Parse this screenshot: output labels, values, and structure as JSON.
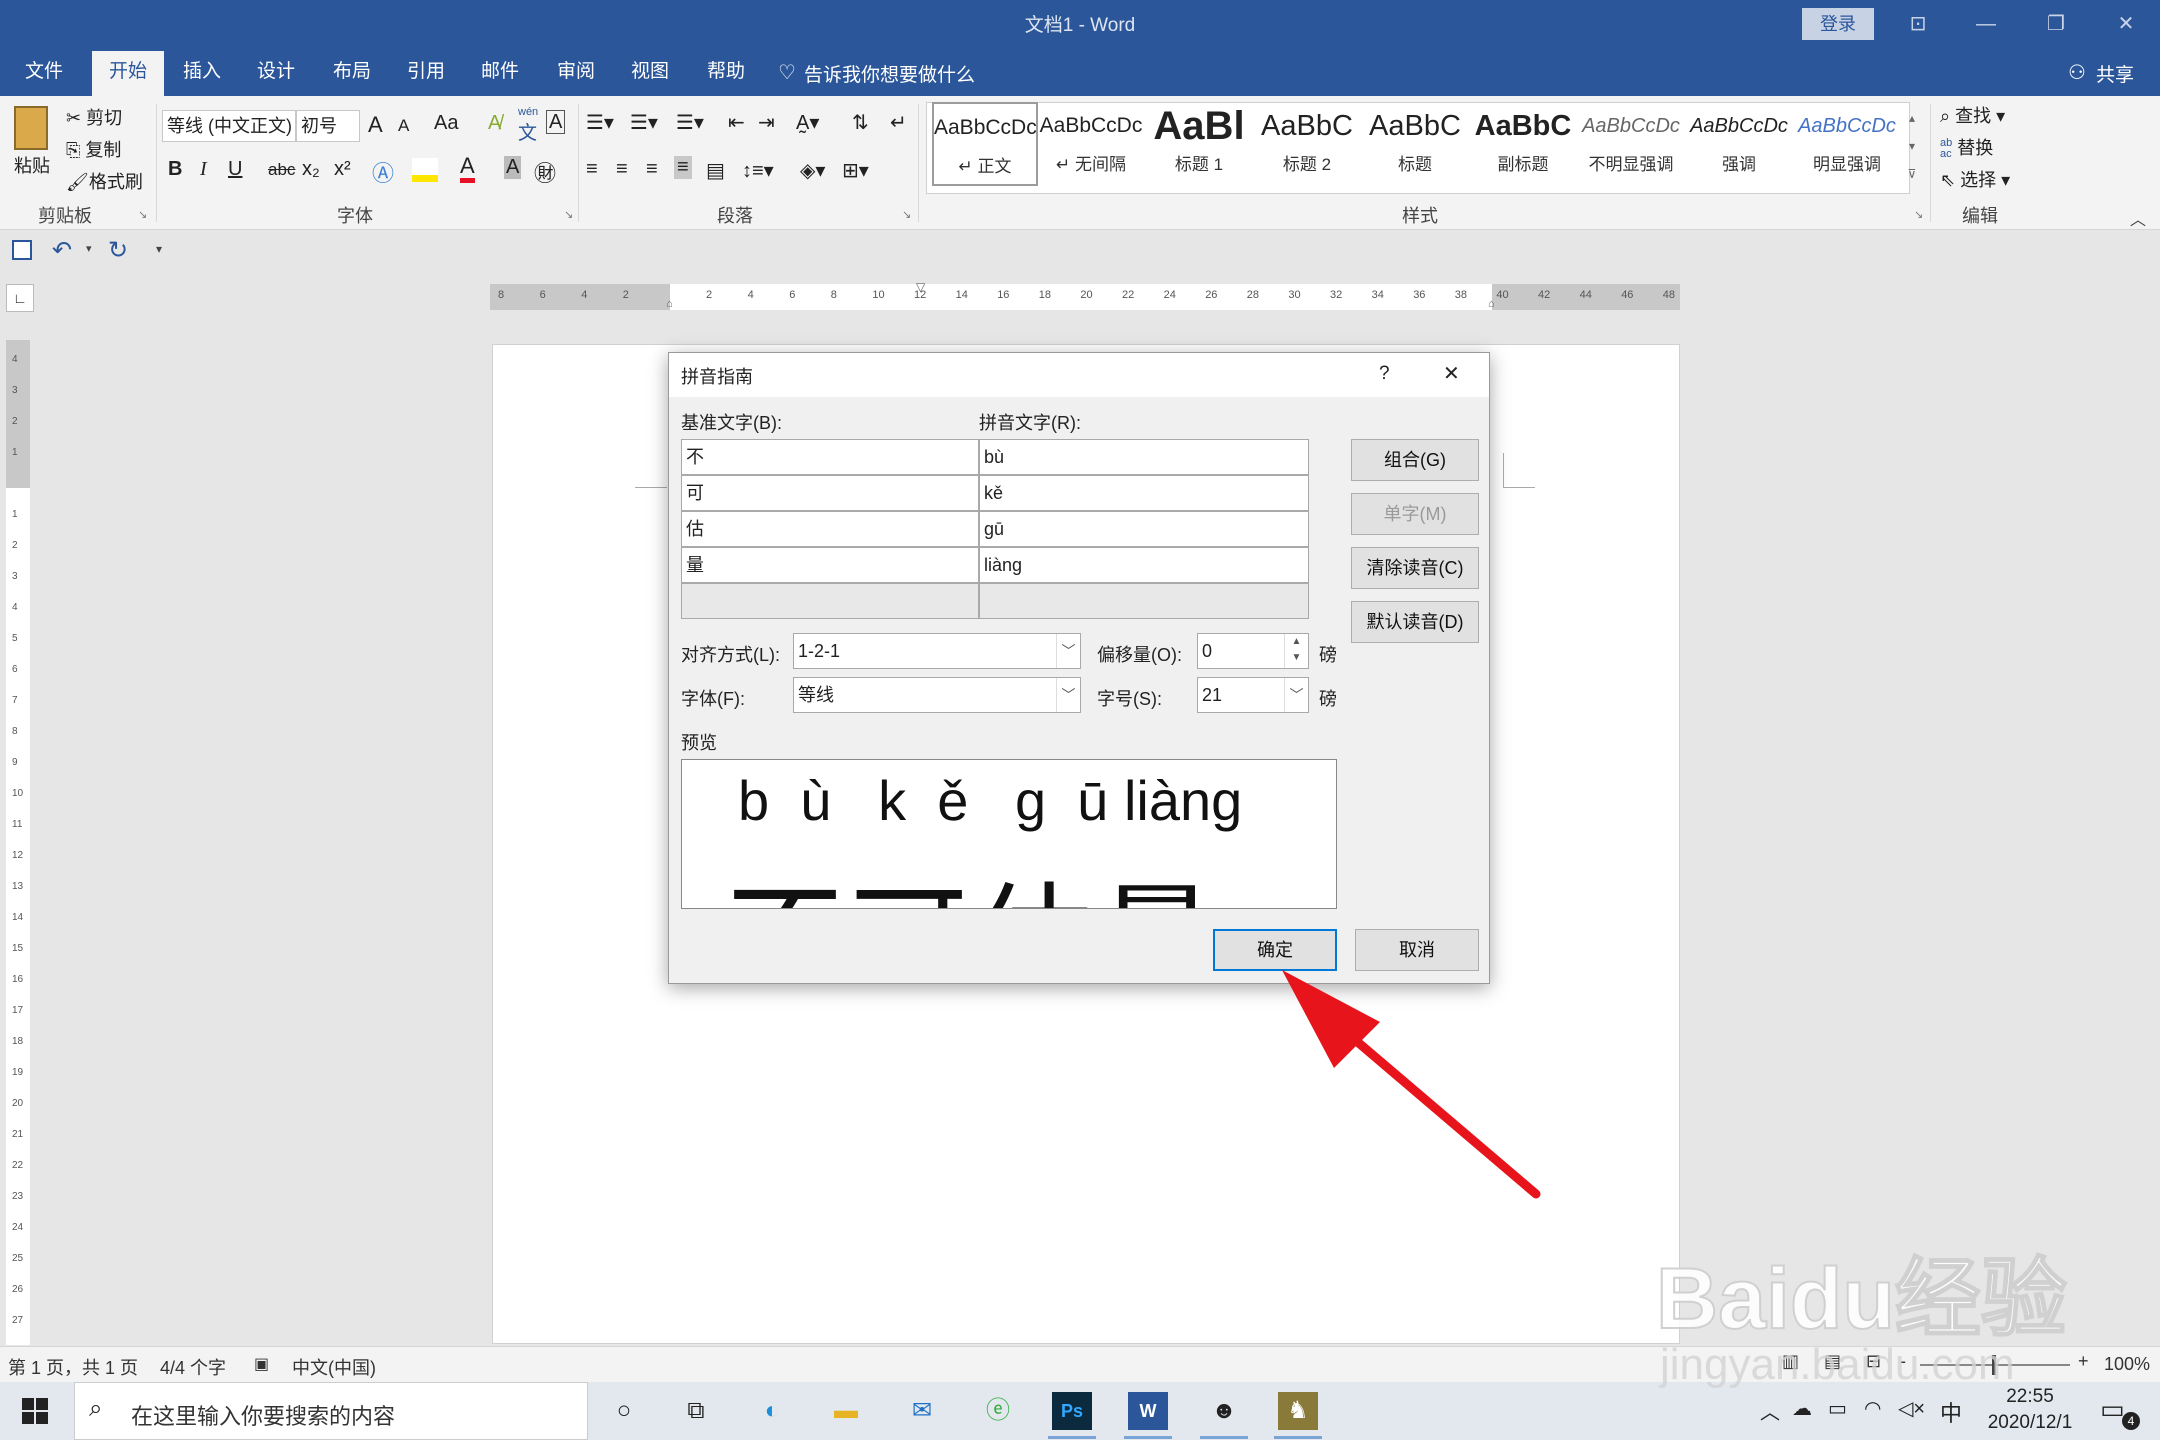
{
  "window": {
    "title": "文档1  -  Word",
    "login": "登录"
  },
  "tabs": [
    "文件",
    "开始",
    "插入",
    "设计",
    "布局",
    "引用",
    "邮件",
    "审阅",
    "视图",
    "帮助"
  ],
  "tell_me": "告诉我你想要做什么",
  "share": "共享",
  "clipboard": {
    "paste": "粘贴",
    "cut": "剪切",
    "copy": "复制",
    "format_painter": "格式刷",
    "group": "剪贴板"
  },
  "font": {
    "name": "等线 (中文正文)",
    "size": "初号",
    "group": "字体",
    "grow": "A",
    "shrink": "A",
    "case": "Aa",
    "bold": "B",
    "italic": "I",
    "underline": "U",
    "strike": "abc",
    "sub": "x₂",
    "sup": "x²",
    "font_color": "A",
    "phonetic_wen": "wén",
    "phonetic_char": "文",
    "char_border": "A",
    "shade": "A"
  },
  "paragraph": {
    "group": "段落"
  },
  "styles": {
    "group": "样式",
    "items": [
      {
        "sample": "AaBbCcDc",
        "name": "↵ 正文"
      },
      {
        "sample": "AaBbCcDc",
        "name": "↵ 无间隔"
      },
      {
        "sample": "AaBl",
        "name": "标题 1"
      },
      {
        "sample": "AaBbC",
        "name": "标题 2"
      },
      {
        "sample": "AaBbC",
        "name": "标题"
      },
      {
        "sample": "AaBbC",
        "name": "副标题"
      },
      {
        "sample": "AaBbCcDc",
        "name": "不明显强调"
      },
      {
        "sample": "AaBbCcDc",
        "name": "强调"
      },
      {
        "sample": "AaBbCcDc",
        "name": "明显强调"
      }
    ]
  },
  "editing": {
    "find": "查找",
    "replace": "替换",
    "select": "选择",
    "group": "编辑",
    "replace_ab": "ab",
    "replace_ac": "ac"
  },
  "ruler_h_labels": [
    "8",
    "6",
    "4",
    "2",
    "",
    "2",
    "4",
    "6",
    "8",
    "10",
    "12",
    "14",
    "16",
    "18",
    "20",
    "22",
    "24",
    "26",
    "28",
    "30",
    "32",
    "34",
    "36",
    "38",
    "40",
    "42",
    "44",
    "46",
    "48"
  ],
  "ruler_v_labels": [
    "4",
    "3",
    "2",
    "1",
    "",
    "1",
    "2",
    "3",
    "4",
    "5",
    "6",
    "7",
    "8",
    "9",
    "10",
    "11",
    "12",
    "13",
    "14",
    "15",
    "16",
    "17",
    "18",
    "19",
    "20",
    "21",
    "22",
    "23",
    "24",
    "25",
    "26",
    "27"
  ],
  "dialog": {
    "title": "拼音指南",
    "help": "?",
    "close": "✕",
    "base_label": "基准文字(B):",
    "ruby_label": "拼音文字(R):",
    "rows": [
      {
        "base": "不",
        "ruby": "bù"
      },
      {
        "base": "可",
        "ruby": "kě"
      },
      {
        "base": "估",
        "ruby": "gū"
      },
      {
        "base": "量",
        "ruby": "liàng"
      }
    ],
    "btn_group": "组合(G)",
    "btn_single": "单字(M)",
    "btn_clear": "清除读音(C)",
    "btn_default": "默认读音(D)",
    "align_label": "对齐方式(L):",
    "align_value": "1-2-1",
    "offset_label": "偏移量(O):",
    "offset_value": "0",
    "offset_unit": "磅",
    "font_label": "字体(F):",
    "font_value": "等线",
    "size_label": "字号(S):",
    "size_value": "21",
    "size_unit": "磅",
    "preview_label": "预览",
    "preview_ruby": "b  ù   k  ě   g  ū liàng",
    "preview_base": "不可估量",
    "ok": "确定",
    "cancel": "取消"
  },
  "status": {
    "page": "第 1 页，共 1 页",
    "words": "4/4 个字",
    "lang": "中文(中国)",
    "zoom": "100%",
    "zoom_plus": "+",
    "zoom_minus": "-"
  },
  "taskbar": {
    "search_placeholder": "在这里输入你要搜索的内容",
    "time": "22:55",
    "date": "2020/12/1",
    "ime": "中",
    "notif_count": "4"
  },
  "watermark": {
    "brand": "Baidu经验",
    "url": "jingyan.baidu.com"
  },
  "colors": {
    "word_blue": "#2b579a",
    "arrow_red": "#e8141c",
    "dialog_focus": "#0078d7"
  }
}
